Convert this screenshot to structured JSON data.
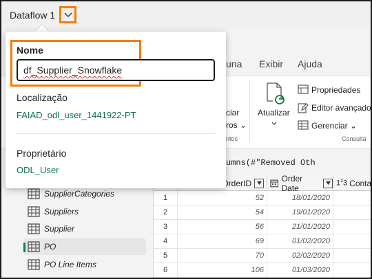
{
  "titlebar": {
    "title": "Dataflow 1"
  },
  "ribbon": {
    "tabs": [
      "una",
      "Exibir",
      "Ajuda"
    ],
    "left_partial": {
      "line1": "ciar",
      "line2": "ros ⌄",
      "group": "ntos"
    },
    "update_label": "Atualizar",
    "buttons": [
      "Propriedades",
      "Editor avançado",
      "Gerenciar ⌄"
    ],
    "group_label": "Consulta"
  },
  "formula": {
    "text": "Table.RenameColumns(#\"Removed Oth"
  },
  "grid": {
    "headers": {
      "order_id": "OrderID",
      "order_date": "Order Date",
      "contact": "Contac"
    },
    "rows": [
      {
        "num": "1",
        "order_id": "52",
        "order_date": "18/01/2020"
      },
      {
        "num": "2",
        "order_id": "54",
        "order_date": "19/01/2020"
      },
      {
        "num": "3",
        "order_id": "56",
        "order_date": "21/01/2020"
      },
      {
        "num": "4",
        "order_id": "69",
        "order_date": "01/02/2020"
      },
      {
        "num": "5",
        "order_id": "70",
        "order_date": "02/02/2020"
      },
      {
        "num": "6",
        "order_id": "106",
        "order_date": "01/03/2020"
      }
    ]
  },
  "queries": {
    "items": [
      "SupplierCategories",
      "Suppliers",
      "Supplier",
      "PO",
      "PO Line Items"
    ],
    "selected": "PO"
  },
  "popup": {
    "name_label": "Nome",
    "name_value": "df_Supplier_Snowflake",
    "location_label": "Localização",
    "location_value": "FAIAD_odl_user_1441922-PT",
    "owner_label": "Proprietário",
    "owner_value": "ODL_User"
  },
  "colors": {
    "accent_orange": "#f57c00",
    "link_green": "#0e6e4e",
    "selection_green": "#107c41"
  }
}
